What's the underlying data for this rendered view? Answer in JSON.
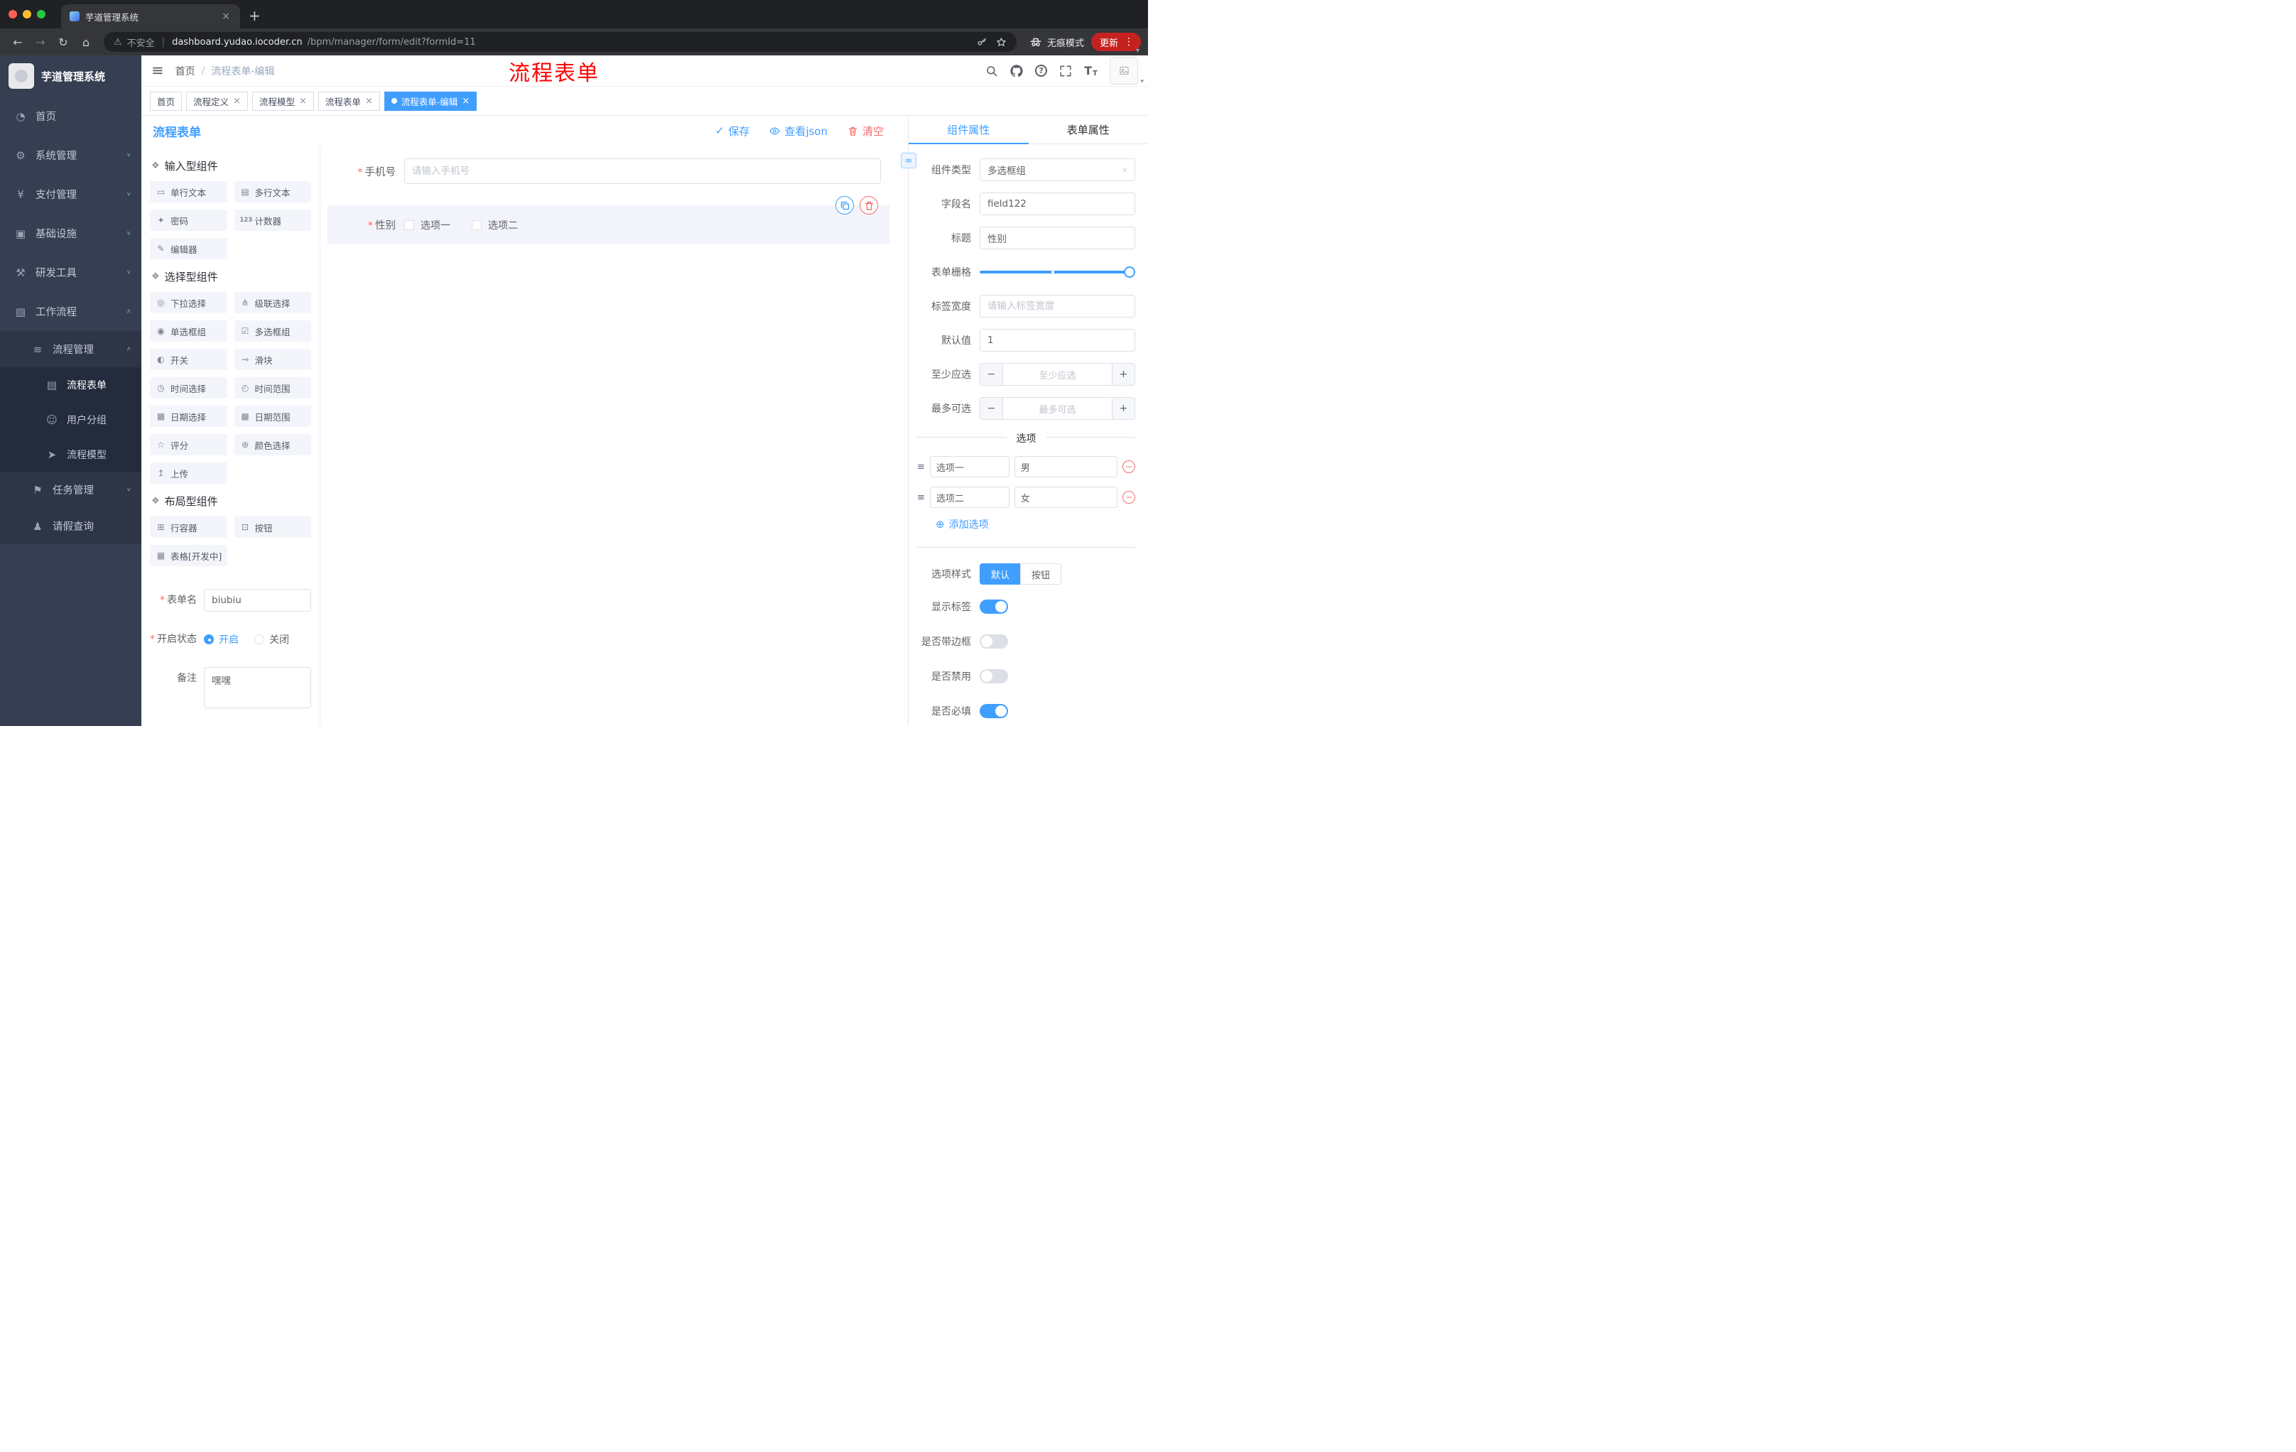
{
  "colors": {
    "accent": "#409EFF",
    "danger": "#F56C6C",
    "annotation": "#FF0000",
    "sidebar_bg": "#363E52"
  },
  "icons": {
    "required": "*",
    "close": "×",
    "plus": "+",
    "kebab": "⋮",
    "back": "←",
    "forward": "→",
    "reload": "↻",
    "home": "⌂",
    "warning": "⚠",
    "divider": "|",
    "hamburger": "≡",
    "check": "✓",
    "dropdown": "∨",
    "minus": "−",
    "add_circle": "⊕",
    "link": "∞",
    "option_handle": "≡",
    "caret_down": "▾",
    "help": "?",
    "text_size": "T"
  },
  "browser": {
    "tab_title": "芋道管理系统",
    "security_label": "不安全",
    "url_host": "dashboard.yudao.iocoder.cn",
    "url_path": "/bpm/manager/form/edit?formId=11",
    "incognito_label": "无痕模式",
    "update_label": "更新"
  },
  "sidebar": {
    "logo_title": "芋道管理系统",
    "items": [
      {
        "icon": "◔",
        "label": "首页",
        "chevron": ""
      },
      {
        "icon": "⚙",
        "label": "系统管理",
        "chevron": "∨"
      },
      {
        "icon": "¥",
        "label": "支付管理",
        "chevron": "∨"
      },
      {
        "icon": "▣",
        "label": "基础设施",
        "chevron": "∨"
      },
      {
        "icon": "⚒",
        "label": "研发工具",
        "chevron": "∨"
      },
      {
        "icon": "▧",
        "label": "工作流程",
        "chevron": "∧"
      }
    ],
    "process_group": {
      "icon": "≡",
      "label": "流程管理",
      "chevron": "∧"
    },
    "process_items": [
      {
        "icon": "▤",
        "label": "流程表单"
      },
      {
        "icon": "☺",
        "label": "用户分组"
      },
      {
        "icon": "➤",
        "label": "流程模型"
      }
    ],
    "task_group": {
      "icon": "⚑",
      "label": "任务管理",
      "chevron": "∨"
    },
    "leave_item": {
      "icon": "♟",
      "label": "请假查询"
    }
  },
  "navbar": {
    "breadcrumb_home": "首页",
    "breadcrumb_sep": "/",
    "breadcrumb_current": "流程表单-编辑",
    "annotation": "流程表单"
  },
  "tags": [
    {
      "label": "首页"
    },
    {
      "label": "流程定义"
    },
    {
      "label": "流程模型"
    },
    {
      "label": "流程表单"
    },
    {
      "label": "流程表单-编辑"
    }
  ],
  "designer": {
    "title": "流程表单",
    "save_label": "保存",
    "view_json_label": "查看json",
    "clear_label": "清空",
    "palette": {
      "sections": [
        {
          "title": "输入型组件",
          "items": [
            {
              "icon": "▭",
              "label": "单行文本"
            },
            {
              "icon": "▤",
              "label": "多行文本"
            },
            {
              "icon": "✦",
              "label": "密码"
            },
            {
              "icon": "123",
              "label": "计数器"
            },
            {
              "icon": "✎",
              "label": "编辑器"
            }
          ]
        },
        {
          "title": "选择型组件",
          "items": [
            {
              "icon": "◎",
              "label": "下拉选择"
            },
            {
              "icon": "⋔",
              "label": "级联选择"
            },
            {
              "icon": "◉",
              "label": "单选框组"
            },
            {
              "icon": "☑",
              "label": "多选框组"
            },
            {
              "icon": "◐",
              "label": "开关"
            },
            {
              "icon": "⊸",
              "label": "滑块"
            },
            {
              "icon": "◷",
              "label": "时间选择"
            },
            {
              "icon": "◴",
              "label": "时间范围"
            },
            {
              "icon": "▦",
              "label": "日期选择"
            },
            {
              "icon": "▩",
              "label": "日期范围"
            },
            {
              "icon": "☆",
              "label": "评分"
            },
            {
              "icon": "⊛",
              "label": "颜色选择"
            },
            {
              "icon": "↥",
              "label": "上传"
            }
          ]
        },
        {
          "title": "布局型组件",
          "items": [
            {
              "icon": "⊞",
              "label": "行容器"
            },
            {
              "icon": "⊡",
              "label": "按钮"
            },
            {
              "icon": "▦",
              "label": "表格[开发中]"
            }
          ]
        }
      ]
    },
    "config": {
      "name_label": "表单名",
      "name_value": "biubiu",
      "status_label": "开启状态",
      "status_on": "开启",
      "status_off": "关闭",
      "remark_label": "备注",
      "remark_value": "嘿嘿"
    },
    "canvas": {
      "phone_label": "手机号",
      "phone_placeholder": "请输入手机号",
      "gender_label": "性别",
      "gender_options": [
        "选项一",
        "选项二"
      ]
    }
  },
  "props": {
    "tabs": [
      "组件属性",
      "表单属性"
    ],
    "component_type_label": "组件类型",
    "component_type_value": "多选框组",
    "field_name_label": "字段名",
    "field_name_value": "field122",
    "title_label": "标题",
    "title_value": "性别",
    "grid_label": "表单栅格",
    "label_width_label": "标签宽度",
    "label_width_placeholder": "请输入标签宽度",
    "default_label": "默认值",
    "default_value": "1",
    "min_label": "至少应选",
    "min_placeholder": "至少应选",
    "max_label": "最多可选",
    "max_placeholder": "最多可选",
    "options_divider": "选项",
    "options": [
      {
        "name": "选项一",
        "value": "男"
      },
      {
        "name": "选项二",
        "value": "女"
      }
    ],
    "add_option_label": "添加选项",
    "option_style_label": "选项样式",
    "option_style_default": "默认",
    "option_style_button": "按钮",
    "switches": [
      {
        "label": "显示标签",
        "on": true
      },
      {
        "label": "是否带边框",
        "on": false
      },
      {
        "label": "是否禁用",
        "on": false
      },
      {
        "label": "是否必填",
        "on": true
      }
    ]
  }
}
